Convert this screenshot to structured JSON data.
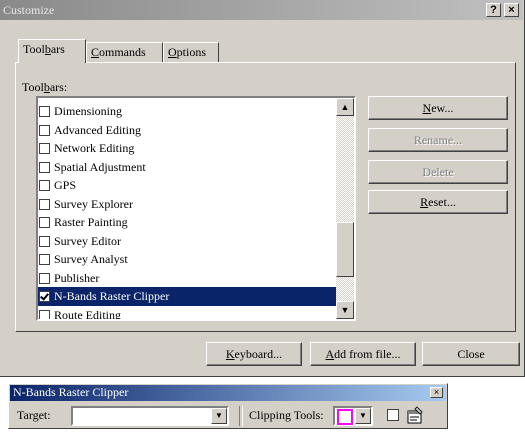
{
  "window": {
    "title": "Customize",
    "help_label": "?",
    "close_label": "×"
  },
  "tabs": [
    {
      "label_pre": "Tool",
      "label_u": "b",
      "label_post": "ars"
    },
    {
      "label_pre": "",
      "label_u": "C",
      "label_post": "ommands"
    },
    {
      "label_pre": "",
      "label_u": "O",
      "label_post": "ptions"
    }
  ],
  "toolbars_label": {
    "pre": "Tool",
    "u": "b",
    "post": "ars:"
  },
  "toolbar_list": [
    {
      "label": "Dimensioning",
      "checked": false
    },
    {
      "label": "Advanced Editing",
      "checked": false
    },
    {
      "label": "Network Editing",
      "checked": false
    },
    {
      "label": "Spatial Adjustment",
      "checked": false
    },
    {
      "label": "GPS",
      "checked": false
    },
    {
      "label": "Survey Explorer",
      "checked": false
    },
    {
      "label": "Raster Painting",
      "checked": false
    },
    {
      "label": "Survey Editor",
      "checked": false
    },
    {
      "label": "Survey Analyst",
      "checked": false
    },
    {
      "label": "Publisher",
      "checked": false
    },
    {
      "label": "N-Bands Raster Clipper",
      "checked": true,
      "selected": true
    },
    {
      "label": "Route Editing",
      "checked": false
    }
  ],
  "side_buttons": {
    "new": {
      "u": "N",
      "post": "ew..."
    },
    "rename": {
      "label": "Rename..."
    },
    "delete": {
      "label": "Delete"
    },
    "reset": {
      "u": "R",
      "post": "eset..."
    }
  },
  "bottom_buttons": {
    "keyboard": {
      "u": "K",
      "post": "eyboard..."
    },
    "add_from_file": {
      "u": "A",
      "post": "dd from file..."
    },
    "close": {
      "label": "Close"
    }
  },
  "floating_toolbar": {
    "title": "N-Bands Raster Clipper",
    "close_label": "×",
    "target_label": "Target:",
    "target_value": "",
    "clipping_label": "Clipping Tools:",
    "clipping_color": "#ff00ff"
  }
}
